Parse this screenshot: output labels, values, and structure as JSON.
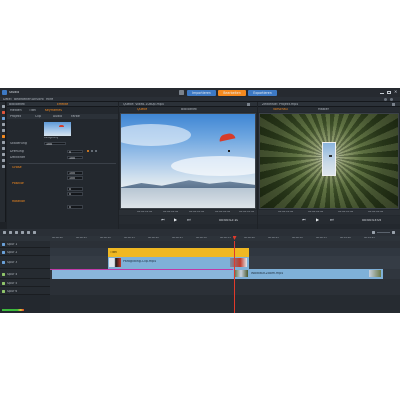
{
  "title_bar": {
    "app_name": "Studio",
    "mode_tabs": [
      {
        "label": "Importieren",
        "active": false
      },
      {
        "label": "Bearbeiten",
        "active": true
      },
      {
        "label": "Exportieren",
        "active": false
      }
    ],
    "window_controls": [
      "minimize-icon",
      "maximize-icon",
      "close-icon"
    ]
  },
  "menubar": {
    "items": [
      "Datei",
      "Bearbeiten",
      "Ansicht",
      "Hilfe"
    ]
  },
  "library_panel": {
    "tabs": [
      "Bibliothek",
      "Effekte"
    ],
    "sub_tabs": [
      "Medien",
      "Titel",
      "Keyframes"
    ],
    "file_tabs": [
      "Projekt",
      "Clip",
      "Audio",
      "Farbe"
    ],
    "thumbnail_label": "Paragliding",
    "props": [
      {
        "label": "Skalierung",
        "value": "100"
      },
      {
        "label": "Drehung",
        "value": "0"
      },
      {
        "label": "Deckkraft",
        "value": "100"
      }
    ],
    "sections": [
      {
        "label": "Größe",
        "values": [
          "100",
          "100"
        ]
      },
      {
        "label": "Position",
        "values": [
          "0",
          "0"
        ]
      },
      {
        "label": "Rotation",
        "values": [
          "0"
        ]
      }
    ]
  },
  "source_player": {
    "title": "Quelle: Video-1080p.mp4",
    "tabs": [
      "Quelle",
      "Bibliothek"
    ],
    "ruler_labels": [
      "00:00:01:00",
      "00:00:02:00",
      "00:00:03:00",
      "00:00:04:00",
      "00:00:05:00"
    ],
    "timecode": "00:00:02:10"
  },
  "timeline_player": {
    "title": "Zeitleiste: Projekt.mp4",
    "tabs": [
      "Vorschau",
      "Master"
    ],
    "ruler_labels": [
      "00:00:01:00",
      "00:00:02:00",
      "00:00:03:00",
      "00:00:04:00"
    ],
    "timecode": "00:00:03:05"
  },
  "timeline": {
    "tracks": [
      {
        "name": "Spur 1",
        "kind": "video"
      },
      {
        "name": "Spur 2",
        "kind": "video"
      },
      {
        "name": "Spur 3",
        "kind": "video"
      },
      {
        "name": "Spur 4",
        "kind": "audio"
      },
      {
        "name": "Spur 5",
        "kind": "audio"
      },
      {
        "name": "Spur 6",
        "kind": "audio"
      }
    ],
    "clips": [
      {
        "label": "Titel",
        "color": "#f0b822"
      },
      {
        "label": "Paragliding-Clip.mp4",
        "color": "#7fb1d8"
      },
      {
        "label": "Waldlauf-Zoom.mp4",
        "color": "#7fb1d8"
      }
    ],
    "ruler_labels": [
      "00:00:00",
      "00:00:05",
      "00:00:10",
      "00:00:15",
      "00:00:20",
      "00:00:25",
      "00:00:30",
      "00:00:35",
      "00:00:40",
      "00:00:45",
      "00:00:50",
      "00:00:55",
      "00:01:00",
      "00:01:05"
    ]
  },
  "colors": {
    "accent_orange": "#f58a1f",
    "clip_yellow": "#f0b822",
    "clip_blue": "#7fb1d8",
    "playhead_red": "#e03a2b",
    "mode_tab_blue": "#3d79c4"
  }
}
